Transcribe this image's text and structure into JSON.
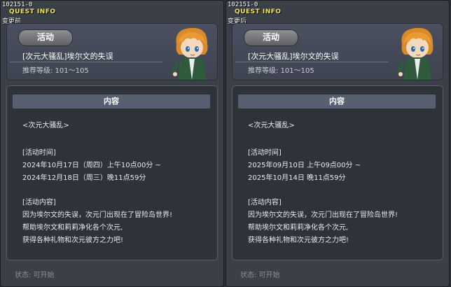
{
  "windows": [
    {
      "id_code": "102151-0",
      "title": "QUEST INFO",
      "state_label": "变更前",
      "event_badge": "活动",
      "quest_name": "[次元大骚乱]埃尔文的失误",
      "recommended_level": "推荐等级:  101～105",
      "content_header": "内容",
      "content_lines": [
        "<次元大骚乱>",
        "",
        "[活动时间]",
        "2024年10月17日（周四）上午10点00分 ~",
        "2024年12月18日（周三）晚11点59分",
        "",
        "[活动内容]",
        "因为埃尔文的失误，次元门出现在了冒险岛世界!",
        "帮助埃尔文和莉莉净化各个次元,",
        "获得各种礼物和次元彼方之力吧!"
      ],
      "status": "状态:  可开始"
    },
    {
      "id_code": "102151-0",
      "title": "QUEST INFO",
      "state_label": "变更后",
      "event_badge": "活动",
      "quest_name": "[次元大骚乱]埃尔文的失误",
      "recommended_level": "推荐等级:  101～105",
      "content_header": "内容",
      "content_lines": [
        "<次元大骚乱>",
        "",
        "[活动时间]",
        "2025年09月10日  上午09点00分 ~",
        "2025年10月14日  晚11点59分",
        "",
        "[活动内容]",
        "因为埃尔文的失误，次元门出现在了冒险岛世界!",
        "帮助埃尔文和莉莉净化各个次元,",
        "获得各种礼物和次元彼方之力吧!"
      ],
      "status": "状态:  可开始"
    }
  ]
}
